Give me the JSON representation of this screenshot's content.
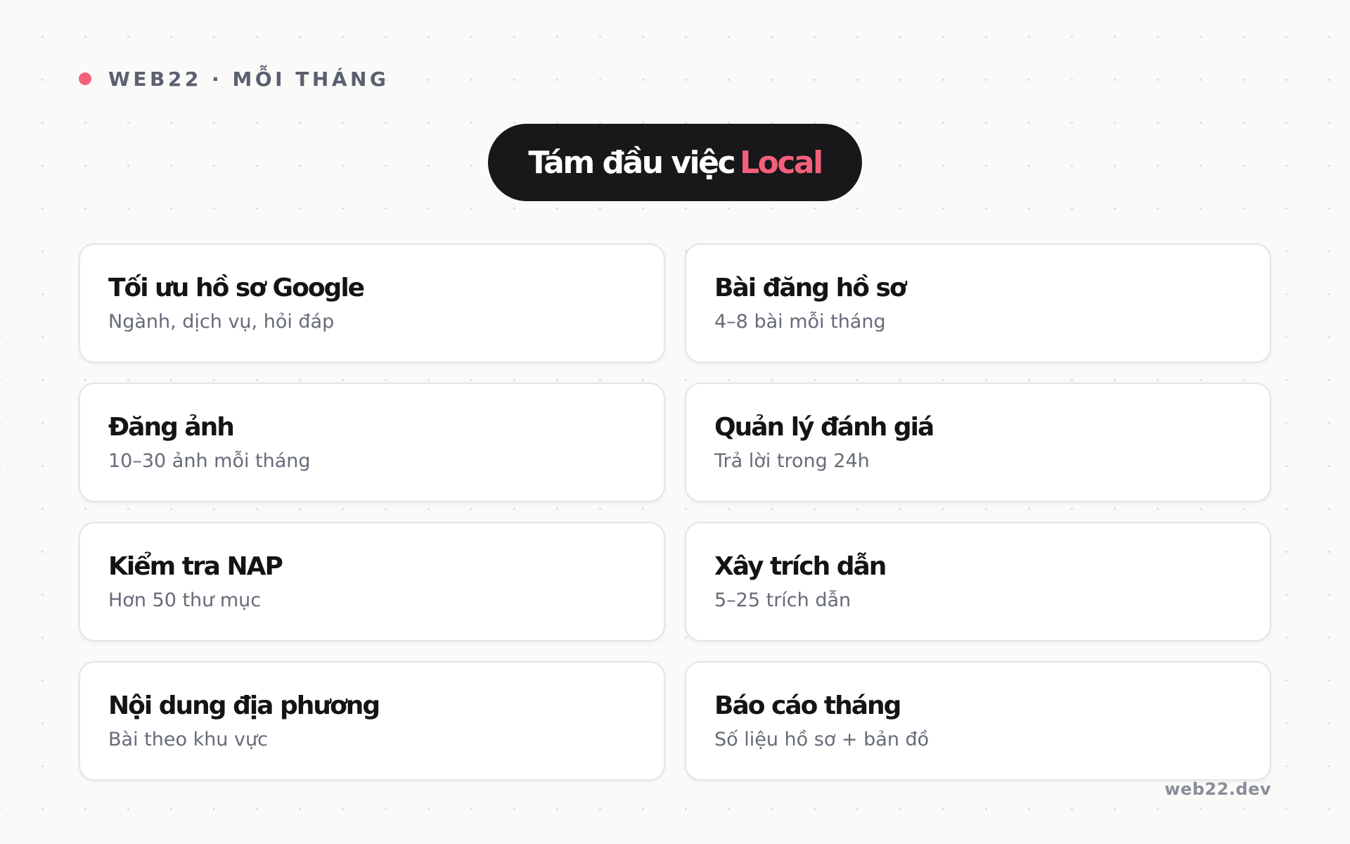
{
  "header": {
    "eyebrow": "WEB22 · MỖI THÁNG",
    "title_main": "Tám đầu việc",
    "title_accent": "Local"
  },
  "cards": [
    {
      "title": "Tối ưu hồ sơ Google",
      "subtitle": "Ngành, dịch vụ, hỏi đáp"
    },
    {
      "title": "Bài đăng hồ sơ",
      "subtitle": "4–8 bài mỗi tháng"
    },
    {
      "title": "Đăng ảnh",
      "subtitle": "10–30 ảnh mỗi tháng"
    },
    {
      "title": "Quản lý đánh giá",
      "subtitle": "Trả lời trong 24h"
    },
    {
      "title": "Kiểm tra NAP",
      "subtitle": "Hơn 50 thư mục"
    },
    {
      "title": "Xây trích dẫn",
      "subtitle": "5–25 trích dẫn"
    },
    {
      "title": "Nội dung địa phương",
      "subtitle": "Bài theo khu vực"
    },
    {
      "title": "Báo cáo tháng",
      "subtitle": "Số liệu hồ sơ + bản đồ"
    }
  ],
  "footer": {
    "brand": "web22.dev"
  },
  "colors": {
    "accent": "#f4607a",
    "pill_background": "#18181b",
    "page_background": "#fafaf9",
    "card_background": "#ffffff",
    "muted_text": "#666b78"
  }
}
